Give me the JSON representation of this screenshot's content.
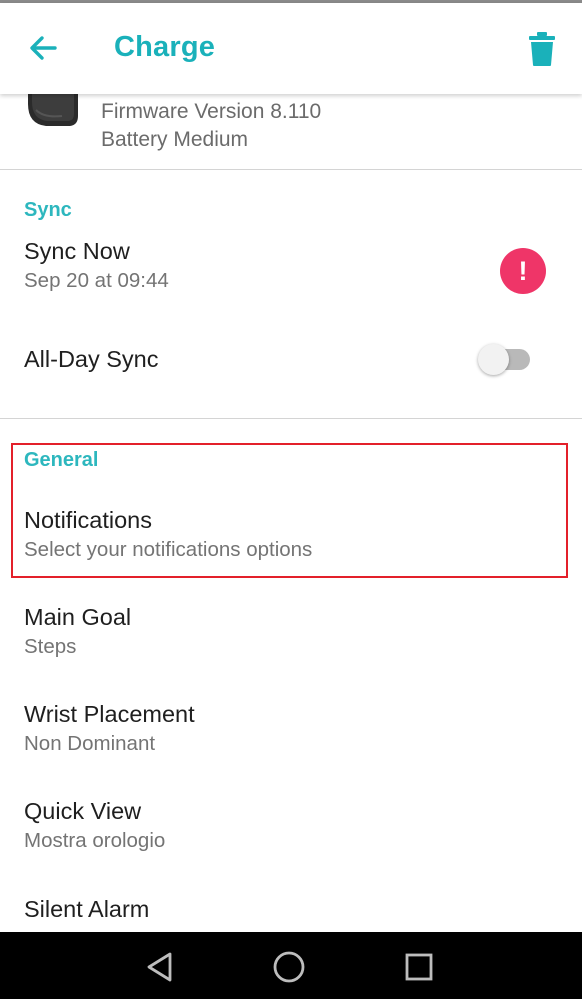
{
  "app_bar": {
    "title": "Charge",
    "back_icon": "arrow-left-icon",
    "delete_icon": "trash-icon",
    "accent_color": "#1ab1ba"
  },
  "device": {
    "firmware": "Firmware Version 8.110",
    "battery": "Battery Medium"
  },
  "sync_section": {
    "header": "Sync",
    "sync_now": {
      "title": "Sync Now",
      "subtitle": "Sep 20 at 09:44",
      "alert_symbol": "!"
    },
    "all_day_sync": {
      "title": "All-Day Sync",
      "enabled": false
    }
  },
  "general_section": {
    "header": "General",
    "items": [
      {
        "title": "Notifications",
        "subtitle": "Select your notifications options"
      },
      {
        "title": "Main Goal",
        "subtitle": "Steps"
      },
      {
        "title": "Wrist Placement",
        "subtitle": "Non Dominant"
      },
      {
        "title": "Quick View",
        "subtitle": "Mostra orologio"
      },
      {
        "title": "Silent Alarm",
        "subtitle": ""
      }
    ]
  },
  "nav_bar": {
    "icons": [
      "back-triangle-icon",
      "home-circle-icon",
      "recents-square-icon"
    ]
  },
  "colors": {
    "section_header": "#2db7be",
    "alert": "#ef3568",
    "highlight": "#e3202a"
  }
}
